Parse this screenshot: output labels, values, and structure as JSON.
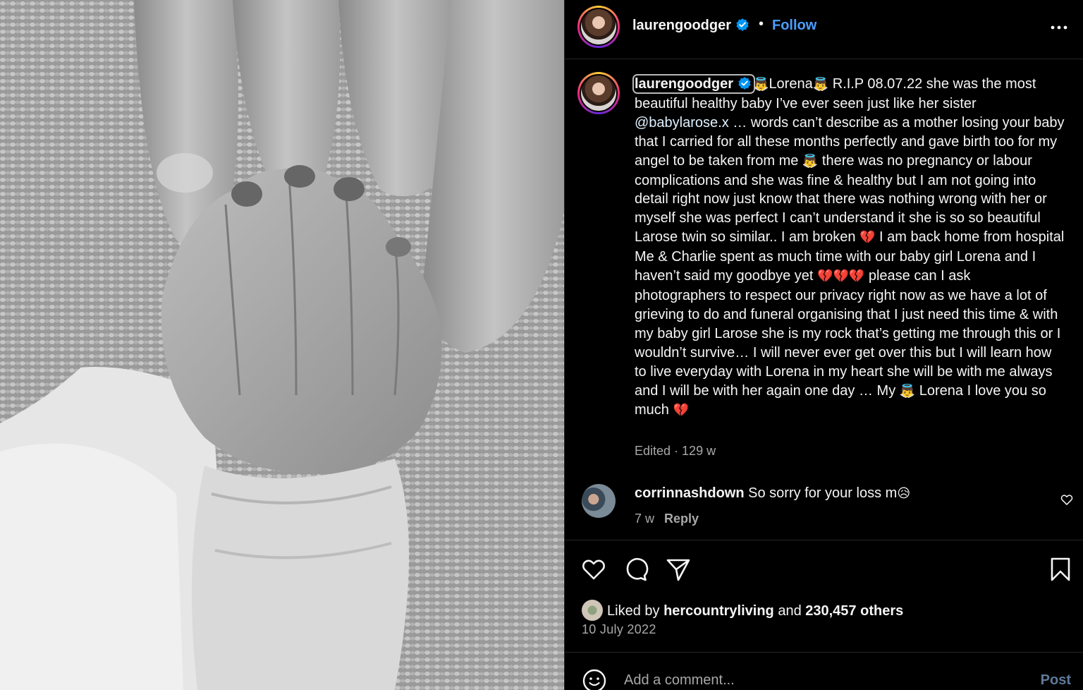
{
  "post": {
    "username": "laurengoodger",
    "verified": true,
    "separator": "•",
    "follow_label": "Follow",
    "more_icon": "more-horizontal-icon"
  },
  "caption": {
    "username": "laurengoodger",
    "emoji_baby": "👼",
    "emoji_broken_heart": "💔",
    "p1": "Lorena",
    "p2": " R.I.P 08.07.22 she was the most beautiful healthy baby I’ve ever seen just like her sister ",
    "mention": "@babylarose.x",
    "p3": " … words can’t describe as a mother losing your baby that I carried for all these months perfectly and gave birth too for my angel to be taken from me ",
    "p4": " there was no pregnancy or labour complications and she was fine & healthy but I am not going into detail right now just know that there was nothing wrong with her or myself she was perfect I can’t understand it she is so so beautiful Larose twin so similar.. I am broken ",
    "p5": " I am back home from hospital Me & Charlie spent as much time with our baby girl Lorena and I haven’t said my goodbye yet ",
    "p6": " please can I ask photographers to respect our privacy right now as we have a lot of grieving to do and funeral organising that I just need this time & with my baby girl Larose she is my rock that’s getting me through this or I wouldn’t survive… I will never ever get over this but I will learn how to live everyday with Lorena in my heart she will be with me always and I will be with her again one day … My ",
    "p7": " Lorena I love you so much ",
    "edited": "Edited",
    "meta_sep": " · ",
    "age": "129 w"
  },
  "comments": [
    {
      "username": "corrinnashdown",
      "text": "So sorry for your loss m",
      "emoji": "😥",
      "age": "7 w",
      "reply_label": "Reply"
    }
  ],
  "actions": {
    "like_icon": "heart-icon",
    "comment_icon": "comment-bubble-icon",
    "share_icon": "send-paper-plane-icon",
    "save_icon": "bookmark-icon"
  },
  "likes": {
    "prefix": "Liked by ",
    "user": "hercountryliving",
    "and": " and ",
    "others": "230,457 others"
  },
  "date": "10 July 2022",
  "comment_box": {
    "placeholder": "Add a comment...",
    "post_label": "Post",
    "emoji_icon": "smiley-face-icon"
  },
  "colors": {
    "background": "#000000",
    "link_blue": "#4a9eff",
    "muted_text": "#a8a8a8",
    "divider": "#262626"
  }
}
